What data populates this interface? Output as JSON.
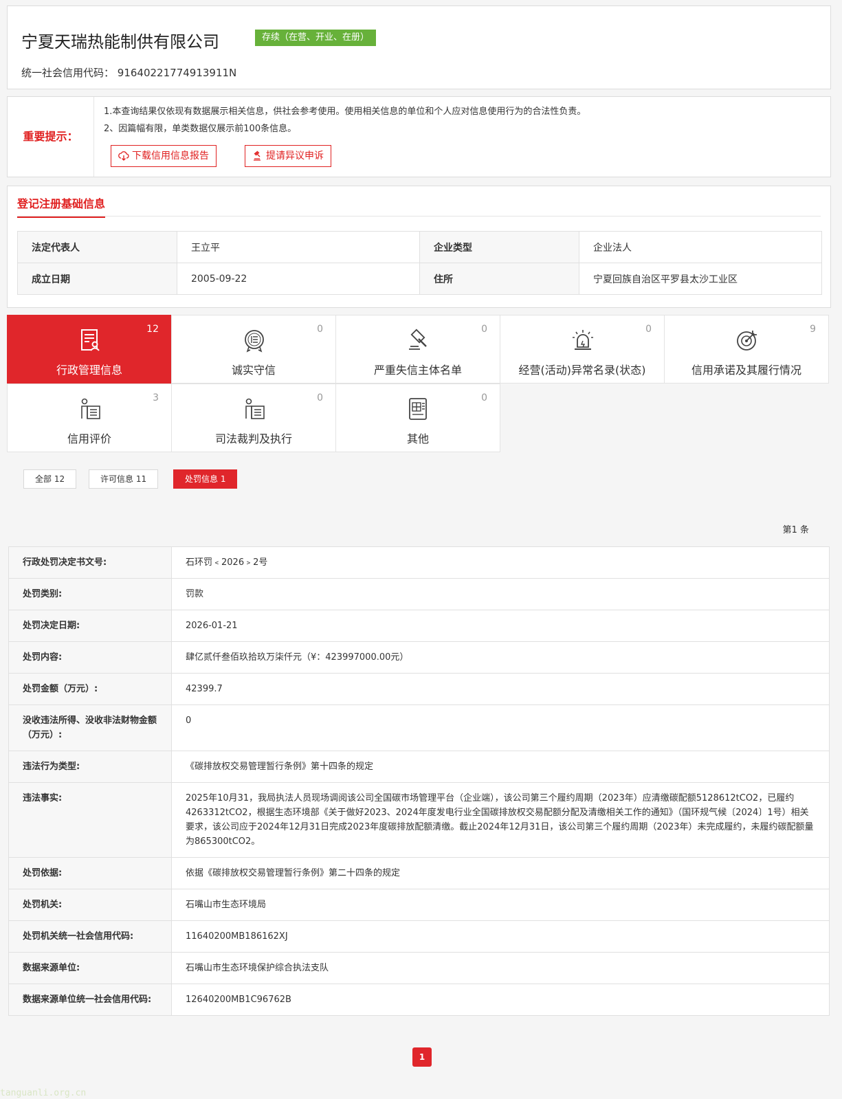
{
  "header": {
    "company_name": "宁夏天瑞热能制供有限公司",
    "status": "存续（在营、开业、在册）",
    "credit_code_label": "统一社会信用代码：",
    "credit_code": "91640221774913911N"
  },
  "notice": {
    "label": "重要提示：",
    "line1": "1.本查询结果仅依现有数据展示相关信息，供社会参考使用。使用相关信息的单位和个人应对信息使用行为的合法性负责。",
    "line2": "2、因篇幅有限，单类数据仅展示前100条信息。",
    "download_btn": "下载信用信息报告",
    "objection_btn": "提请异议申诉"
  },
  "basic": {
    "title": "登记注册基础信息",
    "rows": [
      {
        "k1": "法定代表人",
        "v1": "王立平",
        "k2": "企业类型",
        "v2": "企业法人"
      },
      {
        "k1": "成立日期",
        "v1": "2005-09-22",
        "k2": "住所",
        "v2": "宁夏回族自治区平罗县太沙工业区"
      }
    ]
  },
  "tiles": [
    {
      "label": "行政管理信息",
      "count": "12"
    },
    {
      "label": "诚实守信",
      "count": "0"
    },
    {
      "label": "严重失信主体名单",
      "count": "0"
    },
    {
      "label": "经营(活动)异常名录(状态)",
      "count": "0"
    },
    {
      "label": "信用承诺及其履行情况",
      "count": "9"
    },
    {
      "label": "信用评价",
      "count": "3"
    },
    {
      "label": "司法裁判及执行",
      "count": "0"
    },
    {
      "label": "其他",
      "count": "0"
    }
  ],
  "filters": {
    "all": "全部 12",
    "permit": "许可信息 11",
    "penalty": "处罚信息 1"
  },
  "record_count": "第1 条",
  "details": [
    {
      "k": "行政处罚决定书文号:",
      "v": "石环罚﹤2026﹥2号"
    },
    {
      "k": "处罚类别:",
      "v": "罚款"
    },
    {
      "k": "处罚决定日期:",
      "v": "2026-01-21"
    },
    {
      "k": "处罚内容:",
      "v": "肆亿贰仟叁佰玖拾玖万柒仟元（¥：423997000.00元）"
    },
    {
      "k": "处罚金额（万元）:",
      "v": "42399.7"
    },
    {
      "k": "没收违法所得、没收非法财物金额（万元）:",
      "v": "0"
    },
    {
      "k": "违法行为类型:",
      "v": "《碳排放权交易管理暂行条例》第十四条的规定"
    },
    {
      "k": "违法事实:",
      "v": "2025年10月31，我局执法人员现场调阅该公司全国碳市场管理平台（企业端），该公司第三个履约周期（2023年）应清缴碳配额5128612tCO2，已履约4263312tCO2，根据生态环境部《关于做好2023、2024年度发电行业全国碳排放权交易配额分配及清缴相关工作的通知》（国环规气候〔2024〕1号）相关要求，该公司应于2024年12月31日完成2023年度碳排放配额清缴。截止2024年12月31日，该公司第三个履约周期（2023年）未完成履约，未履约碳配额量为865300tCO2。"
    },
    {
      "k": "处罚依据:",
      "v": "依据《碳排放权交易管理暂行条例》第二十四条的规定"
    },
    {
      "k": "处罚机关:",
      "v": "石嘴山市生态环境局"
    },
    {
      "k": "处罚机关统一社会信用代码:",
      "v": "11640200MB186162XJ"
    },
    {
      "k": "数据来源单位:",
      "v": "石嘴山市生态环境保护综合执法支队"
    },
    {
      "k": "数据来源单位统一社会信用代码:",
      "v": "12640200MB1C96762B"
    }
  ],
  "pager": {
    "current": "1"
  },
  "watermark": "tanguanli.org.cn",
  "colors": {
    "accent": "#e0262b",
    "status_green": "#67b13a"
  }
}
